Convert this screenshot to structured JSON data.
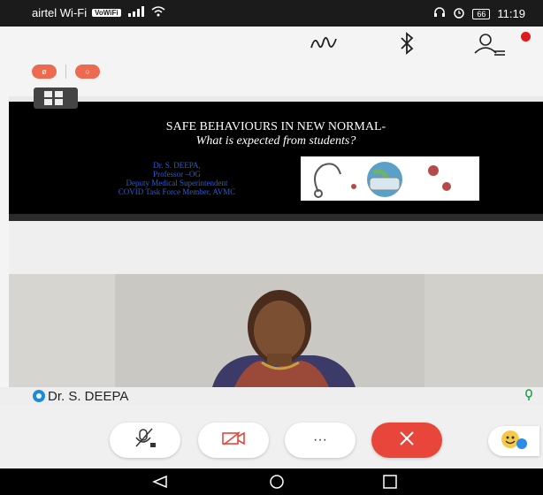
{
  "status_bar": {
    "carrier": "airtel Wi-Fi",
    "volte": "VoWiFi",
    "battery": "66",
    "time": "11:19"
  },
  "toolbar": {
    "icons": [
      "scribble-icon",
      "bluetooth-icon",
      "participants-icon"
    ]
  },
  "pills": [
    "ø",
    "○"
  ],
  "slide": {
    "title": "SAFE BEHAVIOURS IN NEW NORMAL-",
    "subtitle": "What is expected from students?",
    "presenter_lines": [
      "Dr. S. DEEPA,",
      "Professor –OG",
      "Deputy Medical Superintendent",
      "COVID Task Force Member, AVMC"
    ]
  },
  "participant": {
    "name": "Dr. S. DEEPA"
  },
  "controls": {
    "more_label": "···"
  },
  "colors": {
    "hangup": "#e8463a",
    "pill": "#ec6a50",
    "presenter_text": "#2a5cd7",
    "notification_dot": "#e01b1b"
  }
}
